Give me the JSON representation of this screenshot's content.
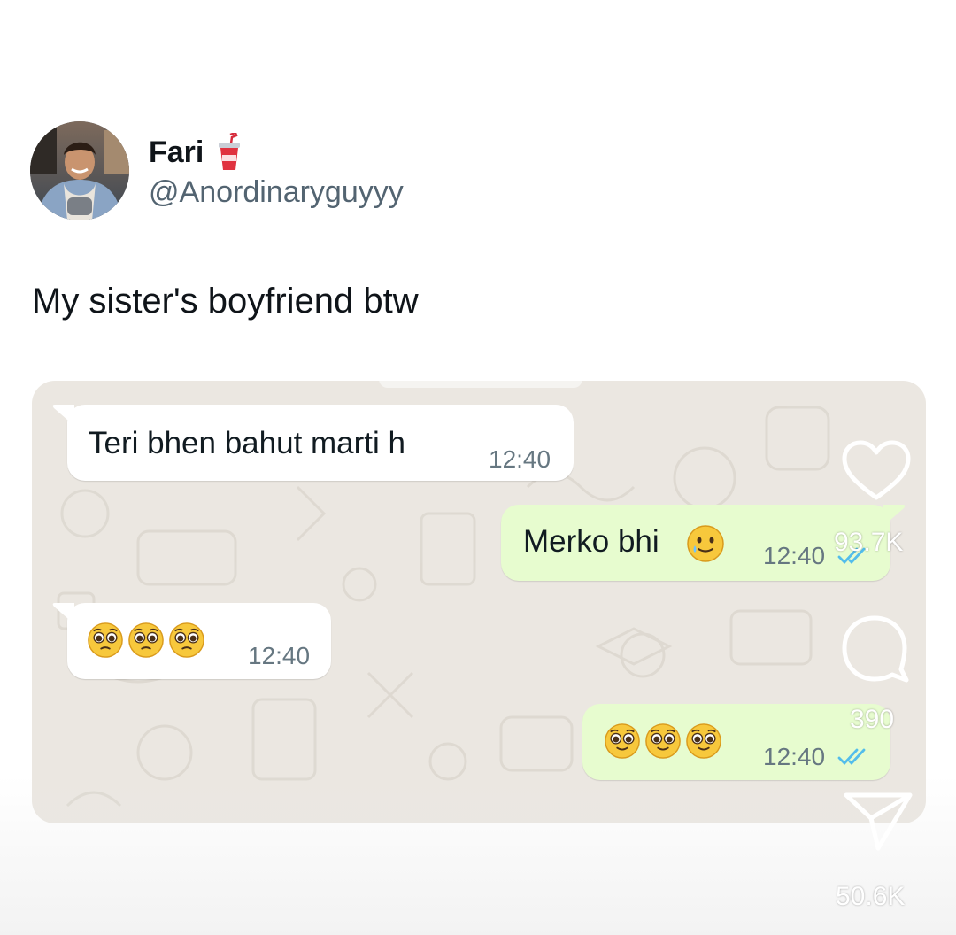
{
  "tweet": {
    "author_name": "Fari",
    "author_handle": "@Anordinaryguyyy",
    "text": "My sister's boyfriend btw",
    "name_emoji_icon": "cup-with-straw-icon"
  },
  "chat": {
    "messages": [
      {
        "direction": "incoming",
        "text": "Teri bhen bahut marti h",
        "time": "12:40"
      },
      {
        "direction": "outgoing",
        "text": "Merko bhi",
        "emoji": "smiling-face-with-tear",
        "time": "12:40",
        "status": "read"
      },
      {
        "direction": "incoming",
        "emojis": [
          "pleading-face",
          "pleading-face",
          "pleading-face"
        ],
        "time": "12:40"
      },
      {
        "direction": "outgoing",
        "emojis": [
          "pleading-face",
          "pleading-face",
          "pleading-face"
        ],
        "time": "12:40",
        "status": "read"
      }
    ]
  },
  "actions": {
    "like": {
      "icon": "heart-icon",
      "count": "93.7K"
    },
    "comment": {
      "icon": "comment-icon",
      "count": "390"
    },
    "share": {
      "icon": "send-icon",
      "count": "50.6K"
    }
  },
  "colors": {
    "chat_background": "#ebe7e1",
    "incoming_bubble": "#ffffff",
    "outgoing_bubble": "#e7fccf",
    "read_ticks": "#53bdeb",
    "handle_gray": "#536471"
  }
}
